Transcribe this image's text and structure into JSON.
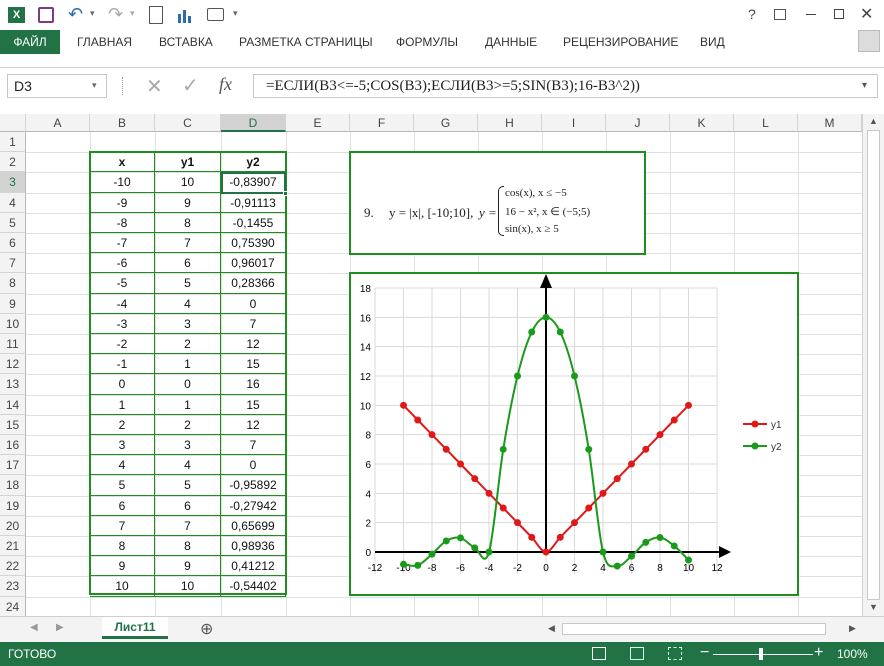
{
  "titlebar": {
    "quick_access_icons": [
      "excel-logo-icon",
      "save-icon",
      "undo-icon",
      "redo-icon",
      "print-preview-icon",
      "chart-icon",
      "camera-icon",
      "customize-icon"
    ],
    "window_buttons": [
      "help-icon",
      "ribbon-display-icon",
      "minimize-icon",
      "restore-icon",
      "close-icon"
    ],
    "help_label": "?"
  },
  "ribbon": {
    "tabs": [
      "ФАЙЛ",
      "ГЛАВНАЯ",
      "ВСТАВКА",
      "РАЗМЕТКА СТРАНИЦЫ",
      "ФОРМУЛЫ",
      "ДАННЫЕ",
      "РЕЦЕНЗИРОВАНИЕ",
      "ВИД"
    ]
  },
  "formula_bar": {
    "name_box": "D3",
    "formula": "=ЕСЛИ(B3<=-5;COS(B3);ЕСЛИ(B3>=5;SIN(B3);16-B3^2))",
    "fx_label": "fx"
  },
  "columns": [
    "A",
    "B",
    "C",
    "D",
    "E",
    "F",
    "G",
    "H",
    "I",
    "J",
    "K",
    "L",
    "M"
  ],
  "rows": [
    "1",
    "2",
    "3",
    "4",
    "5",
    "6",
    "7",
    "8",
    "9",
    "10",
    "11",
    "12",
    "13",
    "14",
    "15",
    "16",
    "17",
    "18",
    "19",
    "20",
    "21",
    "22",
    "23",
    "24"
  ],
  "table": {
    "headers": [
      "x",
      "y1",
      "y2"
    ],
    "rows": [
      [
        "-10",
        "10",
        "-0,83907"
      ],
      [
        "-9",
        "9",
        "-0,91113"
      ],
      [
        "-8",
        "8",
        "-0,1455"
      ],
      [
        "-7",
        "7",
        "0,75390"
      ],
      [
        "-6",
        "6",
        "0,96017"
      ],
      [
        "-5",
        "5",
        "0,28366"
      ],
      [
        "-4",
        "4",
        "0"
      ],
      [
        "-3",
        "3",
        "7"
      ],
      [
        "-2",
        "2",
        "12"
      ],
      [
        "-1",
        "1",
        "15"
      ],
      [
        "0",
        "0",
        "16"
      ],
      [
        "1",
        "1",
        "15"
      ],
      [
        "2",
        "2",
        "12"
      ],
      [
        "3",
        "3",
        "7"
      ],
      [
        "4",
        "4",
        "0"
      ],
      [
        "5",
        "5",
        "-0,95892"
      ],
      [
        "6",
        "6",
        "-0,27942"
      ],
      [
        "7",
        "7",
        "0,65699"
      ],
      [
        "8",
        "8",
        "0,98936"
      ],
      [
        "9",
        "9",
        "0,41212"
      ],
      [
        "10",
        "10",
        "-0,54402"
      ]
    ]
  },
  "task_box": {
    "number": "9.",
    "func": "y = |x|, [-10;10],",
    "piece_lhs": "y =",
    "piece1": "cos(x), x ≤ −5",
    "piece2": "16 − x², x ∈ (−5;5)",
    "piece3": "sin(x), x ≥ 5"
  },
  "chart_data": {
    "type": "line",
    "x": [
      -10,
      -9,
      -8,
      -7,
      -6,
      -5,
      -4,
      -3,
      -2,
      -1,
      0,
      1,
      2,
      3,
      4,
      5,
      6,
      7,
      8,
      9,
      10
    ],
    "series": [
      {
        "name": "y1",
        "color": "#e01818",
        "values": [
          10,
          9,
          8,
          7,
          6,
          5,
          4,
          3,
          2,
          1,
          0,
          1,
          2,
          3,
          4,
          5,
          6,
          7,
          8,
          9,
          10
        ]
      },
      {
        "name": "y2",
        "color": "#1a9a1a",
        "values": [
          -0.83907,
          -0.91113,
          -0.1455,
          0.7539,
          0.96017,
          0.28366,
          0,
          7,
          12,
          15,
          16,
          15,
          12,
          7,
          0,
          -0.95892,
          -0.27942,
          0.65699,
          0.98936,
          0.41212,
          -0.54402
        ]
      }
    ],
    "xlim": [
      -12,
      12
    ],
    "ylim": [
      0,
      18
    ],
    "xticks": [
      "-12",
      "-10",
      "-8",
      "-6",
      "-4",
      "-2",
      "0",
      "2",
      "4",
      "6",
      "8",
      "10",
      "12"
    ],
    "yticks": [
      "0",
      "2",
      "4",
      "6",
      "8",
      "10",
      "12",
      "14",
      "16",
      "18"
    ],
    "grid": true,
    "legend": "right",
    "smooth": true
  },
  "sheet": {
    "tab_name": "Лист11",
    "add_label": "⊕"
  },
  "status": {
    "ready": "ГОТОВО",
    "zoom": "100%"
  }
}
